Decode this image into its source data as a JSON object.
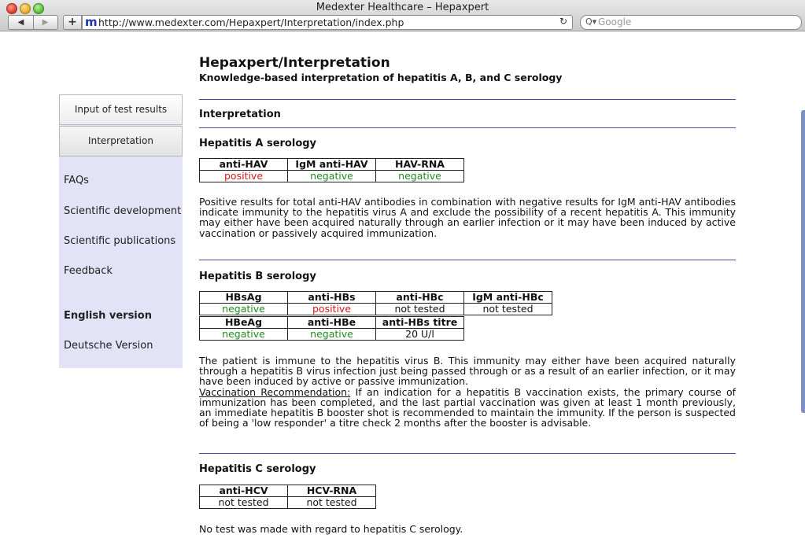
{
  "window": {
    "title": "Medexter Healthcare – Hepaxpert",
    "url": "http://www.medexter.com/Hepaxpert/Interpretation/index.php",
    "favicon_letter": "m",
    "search_placeholder": "Google",
    "back_glyph": "◀",
    "forward_glyph": "▶",
    "add_glyph": "+",
    "reload_glyph": "↻",
    "search_glyph": "Q▾"
  },
  "sidebar": {
    "buttons": [
      "Input of test results",
      "Interpretation"
    ],
    "links": [
      "FAQs",
      "Scientific development",
      "Scientific publications",
      "Feedback"
    ],
    "lang_active": "English version",
    "lang_other": "Deutsche Version"
  },
  "page": {
    "title": "Hepaxpert/Interpretation",
    "subtitle": "Knowledge-based interpretation of hepatitis A, B, and C serology",
    "section_heading": "Interpretation"
  },
  "hep_a": {
    "heading": "Hepatitis A serology",
    "headers": [
      "anti-HAV",
      "IgM anti-HAV",
      "HAV-RNA"
    ],
    "values": [
      "positive",
      "negative",
      "negative"
    ],
    "text": "Positive results for total anti-HAV antibodies in combination with negative results for IgM anti-HAV antibodies indicate immunity to the hepatitis virus A and exclude the possibility of a recent hepatitis A. This immunity may either have been acquired naturally through an earlier infection or it may have been induced by active vaccination or passively acquired immunization."
  },
  "hep_b": {
    "heading": "Hepatitis B serology",
    "headers1": [
      "HBsAg",
      "anti-HBs",
      "anti-HBc",
      "IgM anti-HBc"
    ],
    "values1": [
      "negative",
      "positive",
      "not tested",
      "not tested"
    ],
    "headers2": [
      "HBeAg",
      "anti-HBe",
      "anti-HBs titre"
    ],
    "values2": [
      "negative",
      "negative",
      "20 U/l"
    ],
    "text": "The patient is immune to the hepatitis virus B. This immunity may either have been acquired naturally through a hepatitis B virus infection just being passed through or as a result of an earlier infection, or it may have been induced by active or passive immunization.",
    "vaccination_label": "Vaccination Recommendation:",
    "vaccination_text": " If an indication for a hepatitis B vaccination exists, the primary course of immunization has been completed, and the last partial vaccination was given at least 1 month previously, an immediate hepatitis B booster shot is recommended to maintain the immunity. If the person is suspected of being a 'low responder' a titre check 2 months after the booster is advisable."
  },
  "hep_c": {
    "heading": "Hepatitis C serology",
    "headers": [
      "anti-HCV",
      "HCV-RNA"
    ],
    "values": [
      "not tested",
      "not tested"
    ],
    "text": "No test was made with regard to hepatitis C serology."
  },
  "colors": {
    "positive": "#d41a1a",
    "negative": "#1f8a1f",
    "rule": "#4a4ea0",
    "sidebar": "#e2e3f7"
  }
}
